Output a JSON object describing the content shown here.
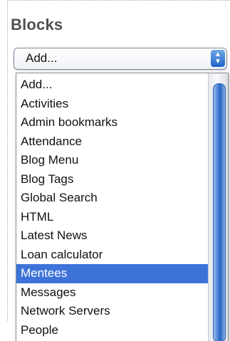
{
  "block": {
    "title": "Blocks",
    "select_value": "Add...",
    "options": [
      "Add...",
      "Activities",
      "Admin bookmarks",
      "Attendance",
      "Blog Menu",
      "Blog Tags",
      "Global Search",
      "HTML",
      "Latest News",
      "Loan calculator",
      "Mentees",
      "Messages",
      "Network Servers",
      "People"
    ],
    "selected_option": "Mentees"
  },
  "icons": {
    "select_arrows": "up-down-chevron-icon"
  },
  "colors": {
    "selection": "#3d73d8",
    "scroll_thumb": "#2a66bf"
  }
}
